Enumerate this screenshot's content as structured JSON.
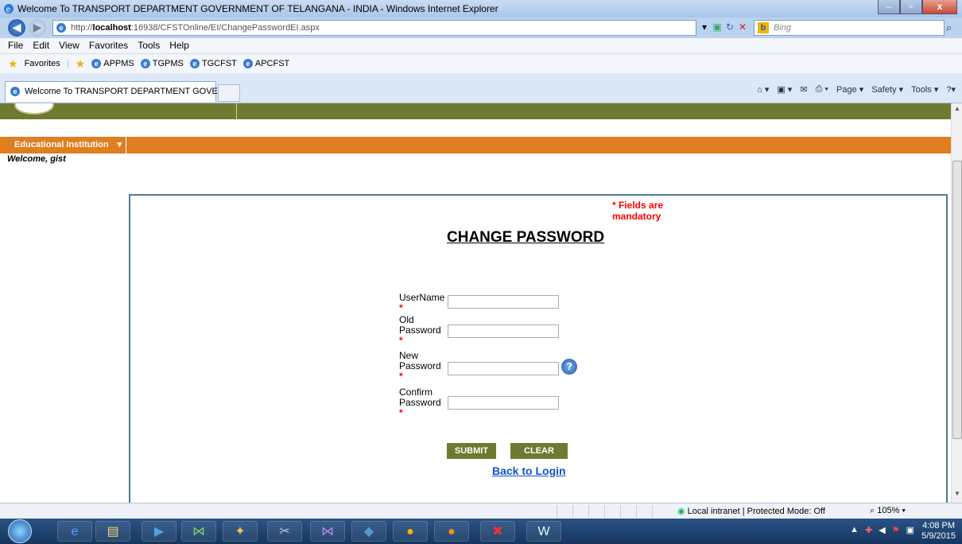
{
  "window": {
    "title": "Welcome To TRANSPORT DEPARTMENT GOVERNMENT OF TELANGANA - INDIA - Windows Internet Explorer"
  },
  "address": {
    "prefix": "http://",
    "host": "localhost",
    "rest": ":16938/CFSTOnline/EI/ChangePasswordEI.aspx"
  },
  "search": {
    "placeholder": "Bing"
  },
  "menubar": [
    "File",
    "Edit",
    "View",
    "Favorites",
    "Tools",
    "Help"
  ],
  "favorites": {
    "label": "Favorites",
    "links": [
      "APPMS",
      "TGPMS",
      "TGCFST",
      "APCFST"
    ]
  },
  "tab": {
    "title": "Welcome To TRANSPORT DEPARTMENT GOVER..."
  },
  "commandbar": [
    "Page ▾",
    "Safety ▾",
    "Tools ▾"
  ],
  "nav": {
    "menu_label": "Educational Institution"
  },
  "welcome": "Welcome, gist",
  "form": {
    "mandatory_note": "* Fields are mandatory",
    "heading": "CHANGE PASSWORD",
    "username_label": "UserName",
    "old_password_label_1": "Old",
    "old_password_label_2": "Password",
    "new_password_label_1": "New",
    "new_password_label_2": "Password",
    "confirm_password_label_1": "Confirm",
    "confirm_password_label_2": "Password",
    "required_marker": "*",
    "submit_label": "SUBMIT",
    "clear_label": "CLEAR",
    "back_link": "Back to Login",
    "help_glyph": "?"
  },
  "status": {
    "zone": "Local intranet | Protected Mode: Off",
    "zoom": "105%"
  },
  "clock": {
    "time": "4:08 PM",
    "date": "5/9/2015"
  },
  "colors": {
    "olive": "#6f7a31",
    "orange": "#e07e20",
    "panel_border": "#4d7a93",
    "required": "#ff0000",
    "link": "#1155cc"
  }
}
